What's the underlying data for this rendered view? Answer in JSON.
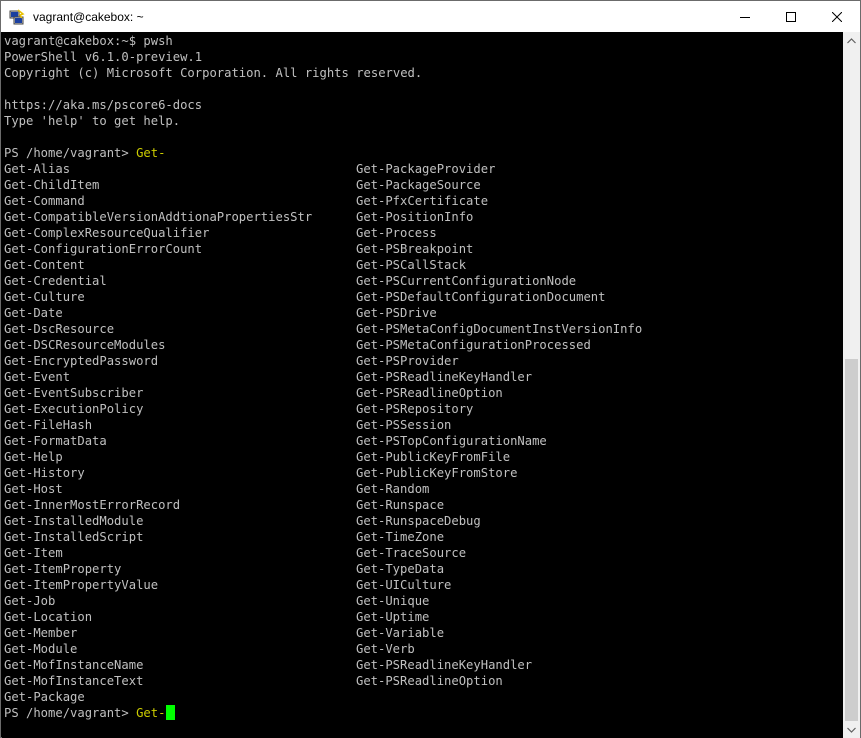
{
  "window": {
    "title": "vagrant@cakebox: ~"
  },
  "header_lines": [
    "vagrant@cakebox:~$ pwsh",
    "PowerShell v6.1.0-preview.1",
    "Copyright (c) Microsoft Corporation. All rights reserved.",
    "",
    "https://aka.ms/pscore6-docs",
    "Type 'help' to get help.",
    ""
  ],
  "prompt": {
    "text": "PS /home/vagrant> ",
    "input": "Get-"
  },
  "completions": {
    "left": [
      "Get-Alias",
      "Get-ChildItem",
      "Get-Command",
      "Get-CompatibleVersionAddtionaPropertiesStr",
      "Get-ComplexResourceQualifier",
      "Get-ConfigurationErrorCount",
      "Get-Content",
      "Get-Credential",
      "Get-Culture",
      "Get-Date",
      "Get-DscResource",
      "Get-DSCResourceModules",
      "Get-EncryptedPassword",
      "Get-Event",
      "Get-EventSubscriber",
      "Get-ExecutionPolicy",
      "Get-FileHash",
      "Get-FormatData",
      "Get-Help",
      "Get-History",
      "Get-Host",
      "Get-InnerMostErrorRecord",
      "Get-InstalledModule",
      "Get-InstalledScript",
      "Get-Item",
      "Get-ItemProperty",
      "Get-ItemPropertyValue",
      "Get-Job",
      "Get-Location",
      "Get-Member",
      "Get-Module",
      "Get-MofInstanceName",
      "Get-MofInstanceText",
      "Get-Package"
    ],
    "right": [
      "Get-PackageProvider",
      "Get-PackageSource",
      "Get-PfxCertificate",
      "Get-PositionInfo",
      "Get-Process",
      "Get-PSBreakpoint",
      "Get-PSCallStack",
      "Get-PSCurrentConfigurationNode",
      "Get-PSDefaultConfigurationDocument",
      "Get-PSDrive",
      "Get-PSMetaConfigDocumentInstVersionInfo",
      "Get-PSMetaConfigurationProcessed",
      "Get-PSProvider",
      "Get-PSReadlineKeyHandler",
      "Get-PSReadlineOption",
      "Get-PSRepository",
      "Get-PSSession",
      "Get-PSTopConfigurationName",
      "Get-PublicKeyFromFile",
      "Get-PublicKeyFromStore",
      "Get-Random",
      "Get-Runspace",
      "Get-RunspaceDebug",
      "Get-TimeZone",
      "Get-TraceSource",
      "Get-TypeData",
      "Get-UICulture",
      "Get-Unique",
      "Get-Uptime",
      "Get-Variable",
      "Get-Verb",
      "Get-PSReadlineKeyHandler",
      "Get-PSReadlineOption"
    ]
  },
  "icons": {
    "app": "putty-icon",
    "minimize": "minimize-icon",
    "maximize": "maximize-icon",
    "close": "close-icon"
  },
  "colors": {
    "background": "#000000",
    "text": "#c0c0c0",
    "highlight": "#cccc00",
    "cursor": "#00ff00"
  }
}
